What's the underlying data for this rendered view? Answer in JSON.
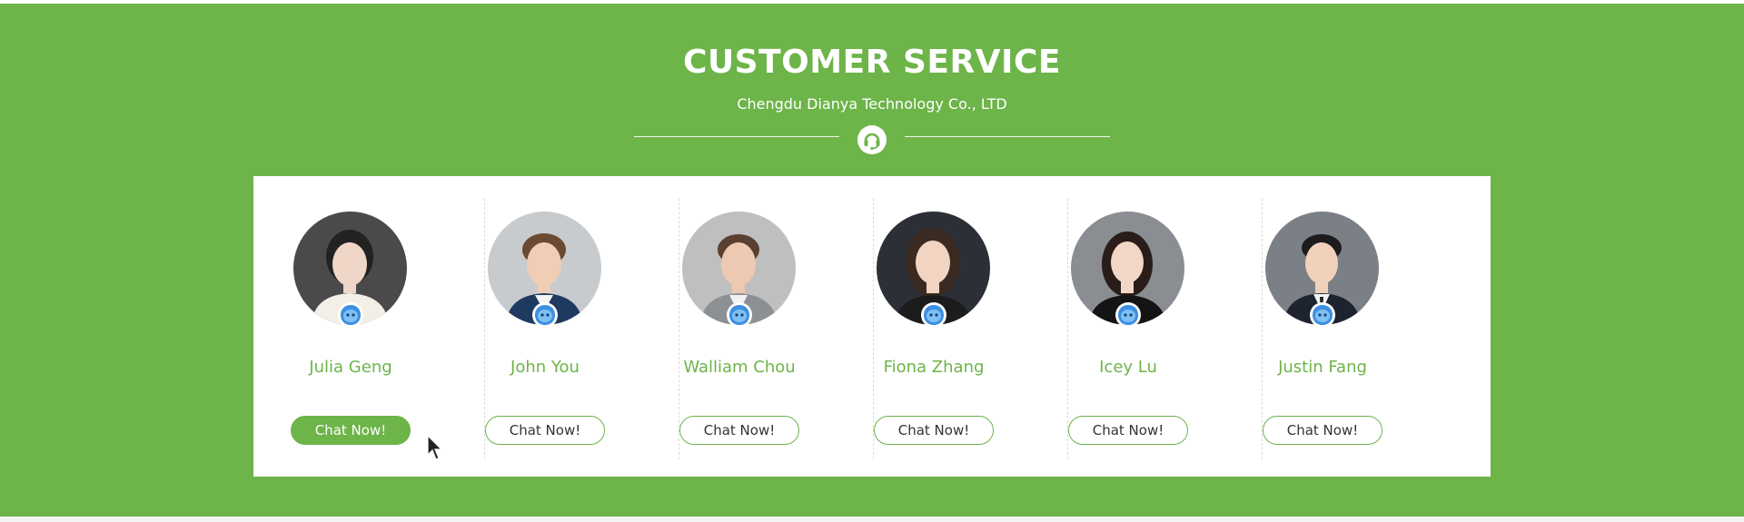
{
  "section": {
    "title": "CUSTOMER SERVICE",
    "subtitle": "Chengdu Dianya Technology Co., LTD",
    "divider_icon": "headset-icon",
    "background_color": "#6db449"
  },
  "agents": [
    {
      "name": "Julia Geng",
      "button_label": "Chat Now!",
      "button_active": true,
      "badge_icon": "chat-mascot-icon"
    },
    {
      "name": "John You",
      "button_label": "Chat Now!",
      "button_active": false,
      "badge_icon": "chat-mascot-icon"
    },
    {
      "name": "Walliam Chou",
      "button_label": "Chat Now!",
      "button_active": false,
      "badge_icon": "chat-mascot-icon"
    },
    {
      "name": "Fiona Zhang",
      "button_label": "Chat Now!",
      "button_active": false,
      "badge_icon": "chat-mascot-icon"
    },
    {
      "name": "Icey Lu",
      "button_label": "Chat Now!",
      "button_active": false,
      "badge_icon": "chat-mascot-icon"
    },
    {
      "name": "Justin Fang",
      "button_label": "Chat Now!",
      "button_active": false,
      "badge_icon": "chat-mascot-icon"
    }
  ],
  "colors": {
    "accent": "#6db449",
    "button_text": "#333333",
    "panel": "#ffffff"
  }
}
